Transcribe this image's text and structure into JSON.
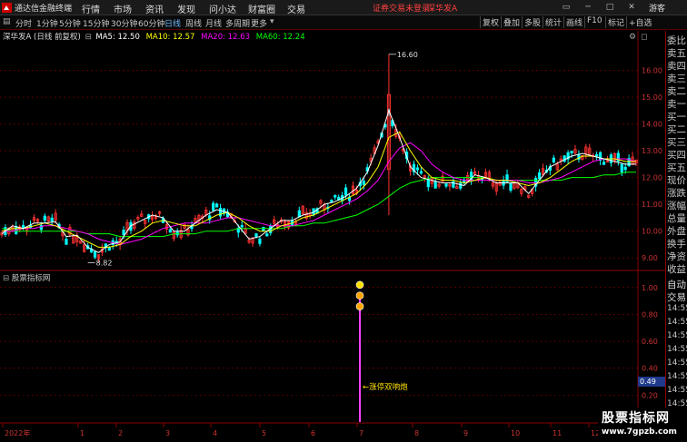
{
  "menubar": {
    "app_title": "通达信金融终端",
    "items": [
      "行情",
      "市场",
      "资讯",
      "发现",
      "问小达",
      "财富圈",
      "交易"
    ],
    "alert": "证券交易未登录",
    "stock_name": "深华发A",
    "window_buttons": [
      "▭",
      "─",
      "□",
      "✕"
    ],
    "guest": "游客"
  },
  "toolbar": {
    "periods": [
      "分时",
      "1分钟",
      "5分钟",
      "15分钟",
      "30分钟",
      "60分钟",
      "日线",
      "周线",
      "月线",
      "多周期",
      "更多"
    ],
    "active_period": "日线",
    "right_buttons": [
      "复权",
      "叠加",
      "多股",
      "统计",
      "画线",
      "F10",
      "标记",
      "+自选"
    ]
  },
  "stock_header": {
    "name": "深华发A",
    "mode": "(日线 前复权)",
    "ma": [
      {
        "label": "MA5: 12.50",
        "color": "#ffffff"
      },
      {
        "label": "MA10: 12.57",
        "color": "#ffff00"
      },
      {
        "label": "MA20: 12.63",
        "color": "#ff00ff"
      },
      {
        "label": "MA60: 12.24",
        "color": "#00ff00"
      }
    ]
  },
  "price_axis": {
    "ticks": [
      "16.00",
      "15.00",
      "14.00",
      "13.00",
      "12.00",
      "11.00",
      "10.00",
      "9.00"
    ]
  },
  "high_marker": "16.60",
  "low_marker": "8.82",
  "indicator": {
    "title": "股票指标网",
    "ticks": [
      "1.00",
      "0.80",
      "0.60",
      "0.40",
      "0.20"
    ],
    "current_value": "0.49",
    "signal_label": "涨停双响炮"
  },
  "time_axis": {
    "labels": [
      "2022年",
      "1",
      "2",
      "3",
      "4",
      "5",
      "6",
      "7",
      "8",
      "9",
      "10",
      "11",
      "12"
    ]
  },
  "side_panel": {
    "labels": [
      "委比",
      "卖五",
      "卖四",
      "卖三",
      "卖二",
      "卖一",
      "买一",
      "买二",
      "买三",
      "买四",
      "买五",
      "现价",
      "涨跌",
      "涨幅",
      "总量",
      "外盘",
      "换手",
      "净资",
      "收益"
    ],
    "trade_title": "自动",
    "trade_sub": "交易",
    "times": [
      "14:55",
      "14:55",
      "14:55",
      "14:55",
      "14:55",
      "14:55",
      "14:55",
      "14:55"
    ]
  },
  "watermark": {
    "title": "股票指标网",
    "url": "www.7gpzb.com"
  },
  "colors": {
    "up": "#ff3232",
    "down": "#00ffff",
    "ma5": "#ffffff",
    "ma10": "#ffff00",
    "ma20": "#ff00ff",
    "ma60": "#00ff00",
    "grid": "#8b0000"
  },
  "chart_data": {
    "type": "candlestick",
    "ma_lines": {
      "ma5": [
        9.9,
        10.2,
        10.1,
        10.3,
        10.3,
        10.35,
        9.8,
        9.85,
        9.4,
        9.2,
        9.5,
        9.6,
        10.2,
        10.4,
        10.6,
        10.5,
        10.0,
        10.0,
        10.3,
        10.6,
        10.8,
        10.7,
        10.2,
        9.7,
        9.8,
        10.1,
        10.4,
        10.4,
        10.6,
        10.7,
        11.0,
        11.1,
        11.3,
        11.6,
        12.2,
        13.2,
        14.5,
        13.5,
        12.4,
        12.0,
        11.9,
        11.8,
        11.8,
        11.7,
        12.1,
        12.0,
        11.8,
        11.8,
        11.8,
        11.4,
        11.9,
        12.4,
        12.6,
        12.8,
        12.9,
        12.8,
        12.7,
        12.6,
        12.5,
        12.5
      ],
      "ma10": [
        10.0,
        10.1,
        10.1,
        10.2,
        10.3,
        10.2,
        10.0,
        9.8,
        9.6,
        9.4,
        9.4,
        9.5,
        9.8,
        10.0,
        10.3,
        10.4,
        10.3,
        10.2,
        10.2,
        10.4,
        10.6,
        10.7,
        10.5,
        10.2,
        10.0,
        10.0,
        10.2,
        10.3,
        10.5,
        10.6,
        10.8,
        11.0,
        11.2,
        11.4,
        11.8,
        12.4,
        13.5,
        13.7,
        13.0,
        12.4,
        12.0,
        11.9,
        11.9,
        11.8,
        11.9,
        12.0,
        11.9,
        11.9,
        11.8,
        11.7,
        11.8,
        12.0,
        12.3,
        12.6,
        12.8,
        12.8,
        12.7,
        12.7,
        12.6,
        12.6
      ],
      "ma20": [
        10.0,
        10.0,
        10.1,
        10.1,
        10.2,
        10.2,
        10.1,
        10.0,
        9.9,
        9.7,
        9.6,
        9.5,
        9.6,
        9.7,
        9.9,
        10.1,
        10.2,
        10.3,
        10.3,
        10.3,
        10.4,
        10.5,
        10.5,
        10.4,
        10.3,
        10.2,
        10.2,
        10.2,
        10.3,
        10.4,
        10.6,
        10.8,
        11.0,
        11.2,
        11.5,
        11.9,
        12.6,
        13.1,
        13.3,
        13.0,
        12.5,
        12.2,
        12.0,
        11.9,
        11.9,
        11.9,
        11.9,
        11.9,
        11.9,
        11.8,
        11.8,
        11.9,
        12.0,
        12.2,
        12.4,
        12.6,
        12.7,
        12.7,
        12.7,
        12.6
      ],
      "ma60": [
        10.1,
        10.0,
        10.0,
        10.0,
        10.0,
        10.0,
        10.0,
        10.0,
        9.9,
        9.9,
        9.9,
        9.8,
        9.8,
        9.8,
        9.8,
        9.8,
        9.9,
        9.9,
        9.9,
        10.0,
        10.0,
        10.0,
        10.1,
        10.1,
        10.1,
        10.1,
        10.1,
        10.2,
        10.2,
        10.3,
        10.3,
        10.4,
        10.5,
        10.6,
        10.8,
        11.0,
        11.3,
        11.6,
        11.8,
        11.9,
        12.0,
        12.0,
        12.0,
        12.0,
        12.0,
        12.0,
        11.9,
        11.9,
        11.9,
        11.9,
        11.9,
        11.9,
        11.9,
        12.0,
        12.0,
        12.0,
        12.1,
        12.1,
        12.2,
        12.2
      ]
    },
    "spike": {
      "high": 16.6,
      "low": 10.6
    },
    "low_point": 8.82,
    "ylim": [
      8.6,
      17.0
    ],
    "indicator_ylim": [
      0.0,
      1.1
    ],
    "indicator_signal_value": 1.0,
    "indicator_current": 0.49,
    "grid": true
  }
}
